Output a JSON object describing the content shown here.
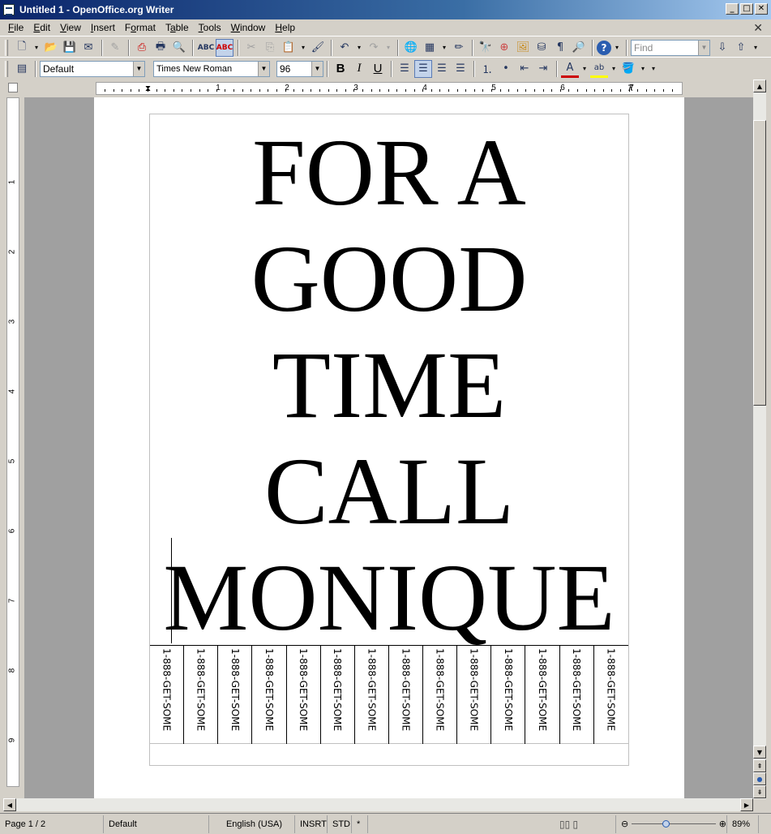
{
  "window": {
    "title": "Untitled 1 - OpenOffice.org Writer"
  },
  "menu": [
    {
      "label": "File",
      "key": "F",
      "rest": "ile"
    },
    {
      "label": "Edit",
      "key": "E",
      "rest": "dit"
    },
    {
      "label": "View",
      "key": "V",
      "rest": "iew"
    },
    {
      "label": "Insert",
      "key": "I",
      "rest": "nsert"
    },
    {
      "label": "Format",
      "key": "o",
      "pre": "F",
      "rest": "rmat"
    },
    {
      "label": "Table",
      "key": "a",
      "pre": "T",
      "rest": "ble"
    },
    {
      "label": "Tools",
      "key": "T",
      "rest": "ools"
    },
    {
      "label": "Window",
      "key": "W",
      "rest": "indow"
    },
    {
      "label": "Help",
      "key": "H",
      "rest": "elp"
    }
  ],
  "toolbar2": {
    "paragraph_style": "Default",
    "font_name": "Times New Roman",
    "font_size": "96",
    "bold": "B",
    "italic": "I",
    "underline": "U"
  },
  "search": {
    "placeholder": "Find"
  },
  "ruler": {
    "h_numbers": [
      "1",
      "2",
      "3",
      "4",
      "5",
      "6",
      "7"
    ],
    "v_numbers": [
      "1",
      "2",
      "3",
      "4",
      "5",
      "6",
      "7",
      "8",
      "9"
    ]
  },
  "document": {
    "lines": [
      "FOR A",
      "GOOD",
      "TIME",
      "CALL",
      "MONIQUE"
    ],
    "tabs": [
      "1-888-GET-SOME",
      "1-888-GET-SOME",
      "1-888-GET-SOME",
      "1-888-GET-SOME",
      "1-888-GET-SOME",
      "1-888-GET-SOME",
      "1-888-GET-SOME",
      "1-888-GET-SOME",
      "1-888-GET-SOME",
      "1-888-GET-SOME",
      "1-888-GET-SOME",
      "1-888-GET-SOME",
      "1-888-GET-SOME",
      "1-888-GET-SOME"
    ]
  },
  "status": {
    "page": "Page 1 / 2",
    "style": "Default",
    "language": "English (USA)",
    "insert_mode": "INSRT",
    "selection_mode": "STD",
    "modified": "*",
    "zoom": "89%"
  }
}
